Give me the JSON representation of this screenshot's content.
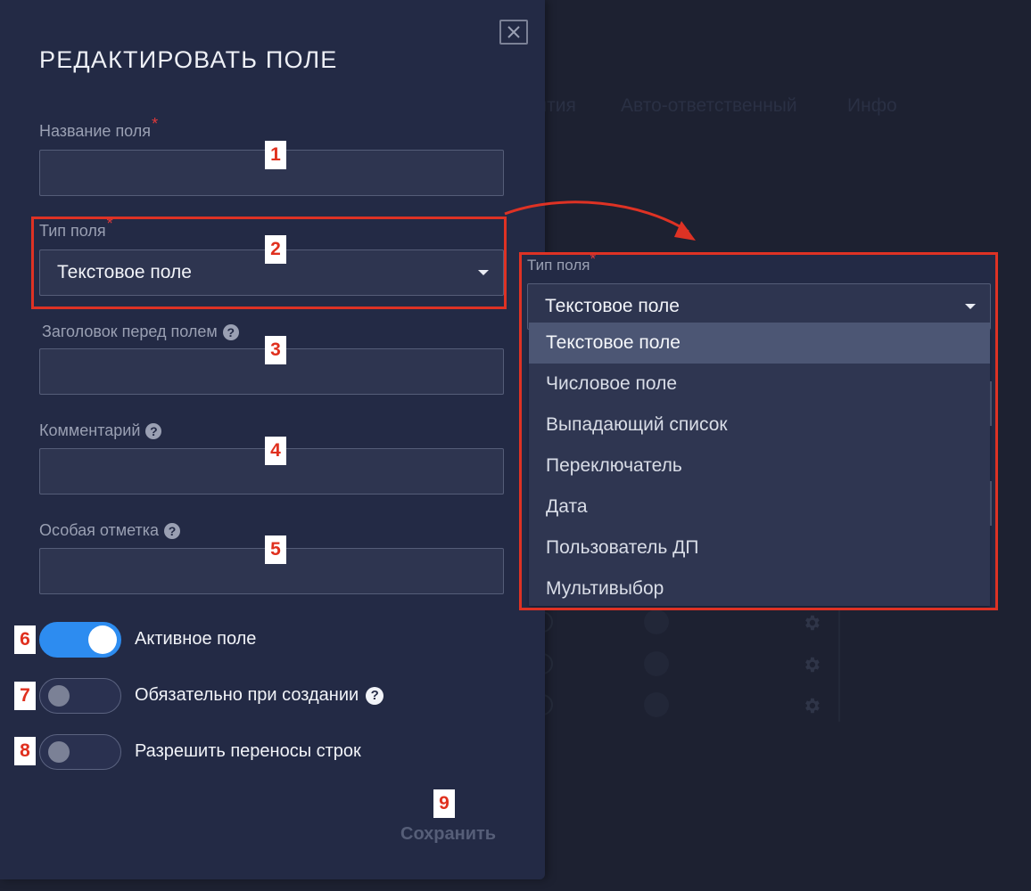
{
  "background": {
    "tabs": [
      "ытия",
      "Авто-ответственный",
      "Инфо"
    ]
  },
  "modal": {
    "title": "РЕДАКТИРОВАТЬ ПОЛЕ",
    "fields": {
      "name": {
        "label": "Название поля",
        "required": "*",
        "value": ""
      },
      "type": {
        "label": "Тип поля",
        "required": "*",
        "value": "Текстовое поле"
      },
      "header": {
        "label": "Заголовок перед полем",
        "value": ""
      },
      "comment": {
        "label": "Комментарий",
        "value": ""
      },
      "special": {
        "label": "Особая отметка",
        "value": ""
      }
    },
    "toggles": [
      {
        "label": "Активное поле",
        "on": true
      },
      {
        "label": "Обязательно при создании",
        "on": false
      },
      {
        "label": "Разрешить переносы строк",
        "on": false
      }
    ],
    "save_label": "Сохранить",
    "help_glyph": "?"
  },
  "preview": {
    "label": "Тип поля",
    "required": "*",
    "value": "Текстовое поле",
    "options": [
      "Текстовое поле",
      "Числовое поле",
      "Выпадающий список",
      "Переключатель",
      "Дата",
      "Пользователь ДП",
      "Мультивыбор"
    ],
    "selected_index": 0
  },
  "annotations": [
    "1",
    "2",
    "3",
    "4",
    "5",
    "6",
    "7",
    "8",
    "9"
  ],
  "colors": {
    "accent": "#2d8cf0",
    "annotation_red": "#de3224",
    "modal_bg": "#232a45",
    "required_star": "#e23a3a"
  }
}
